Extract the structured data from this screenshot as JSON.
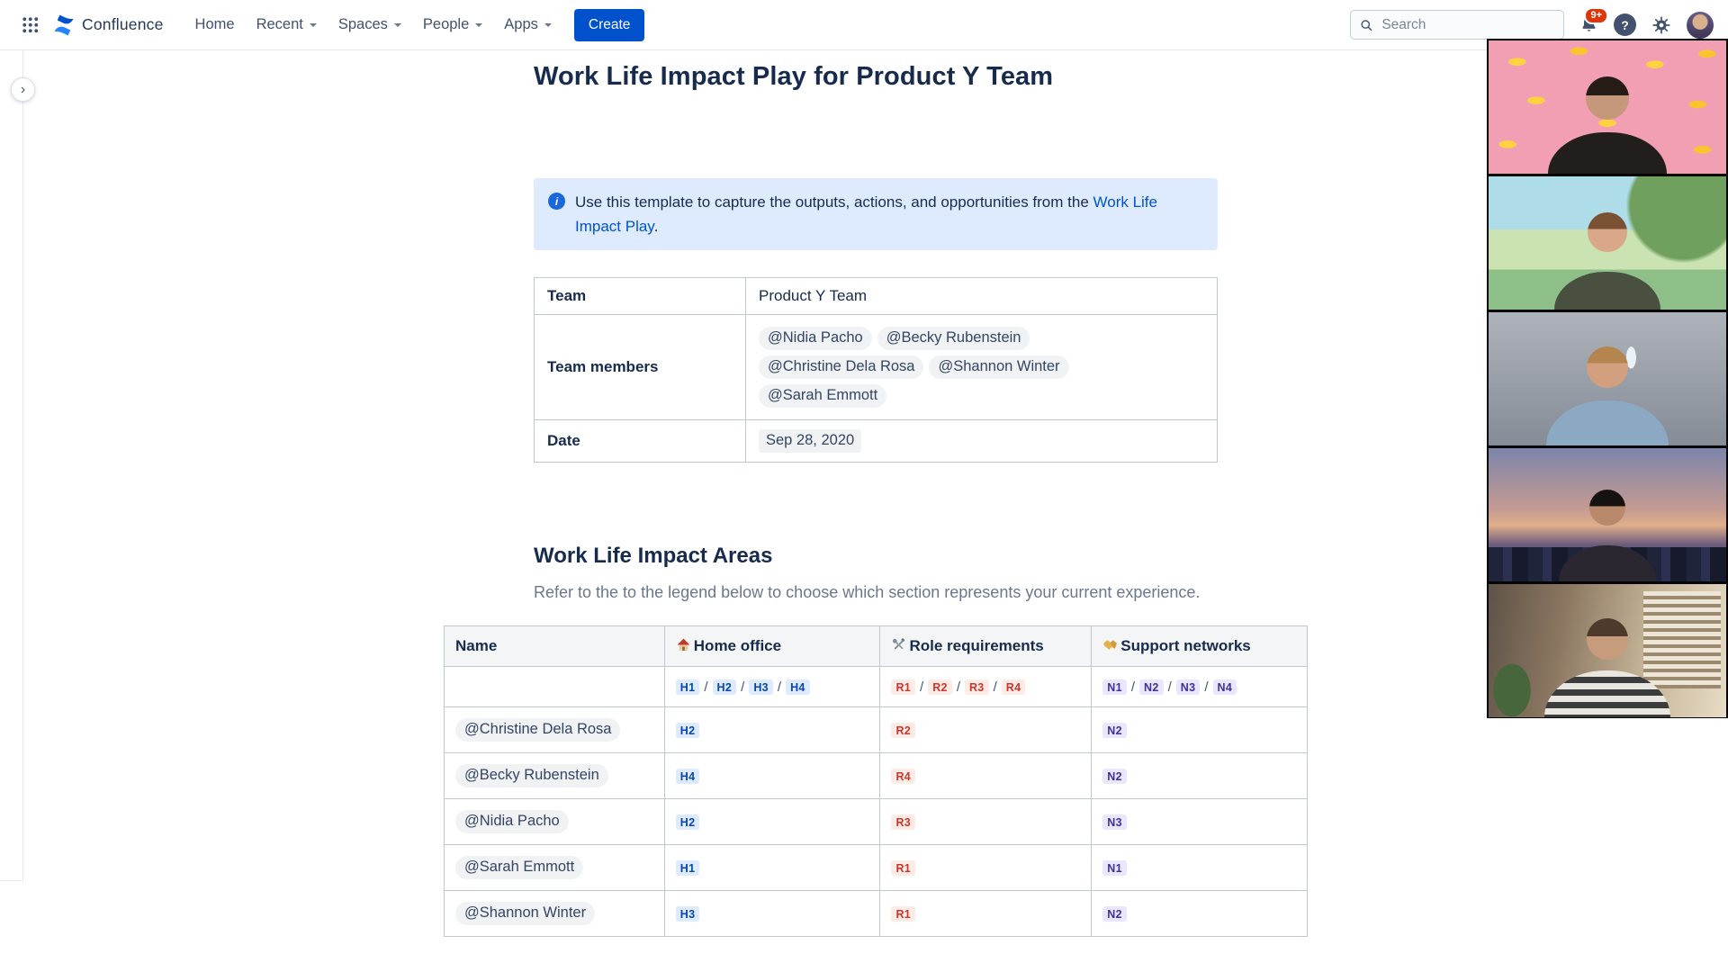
{
  "topbar": {
    "product_name": "Confluence",
    "nav_items": [
      {
        "label": "Home"
      },
      {
        "label": "Recent"
      },
      {
        "label": "Spaces"
      },
      {
        "label": "People"
      },
      {
        "label": "Apps"
      }
    ],
    "create_button": "Create",
    "search": {
      "placeholder": "Search"
    },
    "notifications_badge": "9+"
  },
  "page": {
    "title": "Work Life Impact Play for Product Y Team",
    "info_panel": {
      "text": "Use this template to capture the outputs, actions, and opportunities from the ",
      "link": "Work Life Impact Play",
      "suffix": "."
    },
    "team_table": {
      "team_label": "Team",
      "team_value": "Product Y Team",
      "members_label": "Team members",
      "members": [
        "@Nidia Pacho",
        "@Becky Rubenstein",
        "@Christine Dela Rosa",
        "@Shannon Winter",
        "@Sarah Emmott"
      ],
      "date_label": "Date",
      "date_value": "Sep 28, 2020"
    },
    "section_heading": "Work Life Impact Areas",
    "section_subtitle": "Refer to the to the legend below to choose which section represents your current experience.",
    "impact_table": {
      "headers": {
        "name": "Name",
        "home": "Home office",
        "role": "Role requirements",
        "support": "Support networks"
      },
      "legend": {
        "separator": "/",
        "home": [
          "H1",
          "H2",
          "H3",
          "H4"
        ],
        "role": [
          "R1",
          "R2",
          "R3",
          "R4"
        ],
        "support": [
          "N1",
          "N2",
          "N3",
          "N4"
        ]
      },
      "rows": [
        {
          "name": "@Christine Dela Rosa",
          "home": "H2",
          "role": "R2",
          "support": "N2"
        },
        {
          "name": "@Becky Rubenstein",
          "home": "H4",
          "role": "R4",
          "support": "N2"
        },
        {
          "name": "@Nidia Pacho",
          "home": "H2",
          "role": "R3",
          "support": "N3"
        },
        {
          "name": "@Sarah Emmott",
          "home": "H1",
          "role": "R1",
          "support": "N1"
        },
        {
          "name": "@Shannon Winter",
          "home": "H3",
          "role": "R1",
          "support": "N2"
        }
      ]
    }
  },
  "video_call": {
    "participant_count": 5,
    "participants": [
      "person wearing headset, banana pattern background",
      "person against illustrated outdoor background",
      "person drinking from a water bottle",
      "person with city skyline background",
      "person in striped shirt with window blinds and plant"
    ]
  },
  "colors": {
    "brand_blue": "#0052CC",
    "info_panel_bg": "#DEEBFF",
    "lozenge_home_text": "#0747A6",
    "lozenge_home_bg": "#DEEBFF",
    "lozenge_role_text": "#C9372C",
    "lozenge_role_bg": "#FFEBE6",
    "lozenge_support_text": "#403294",
    "lozenge_support_bg": "#EAE6FF",
    "badge_red": "#DE350B"
  }
}
